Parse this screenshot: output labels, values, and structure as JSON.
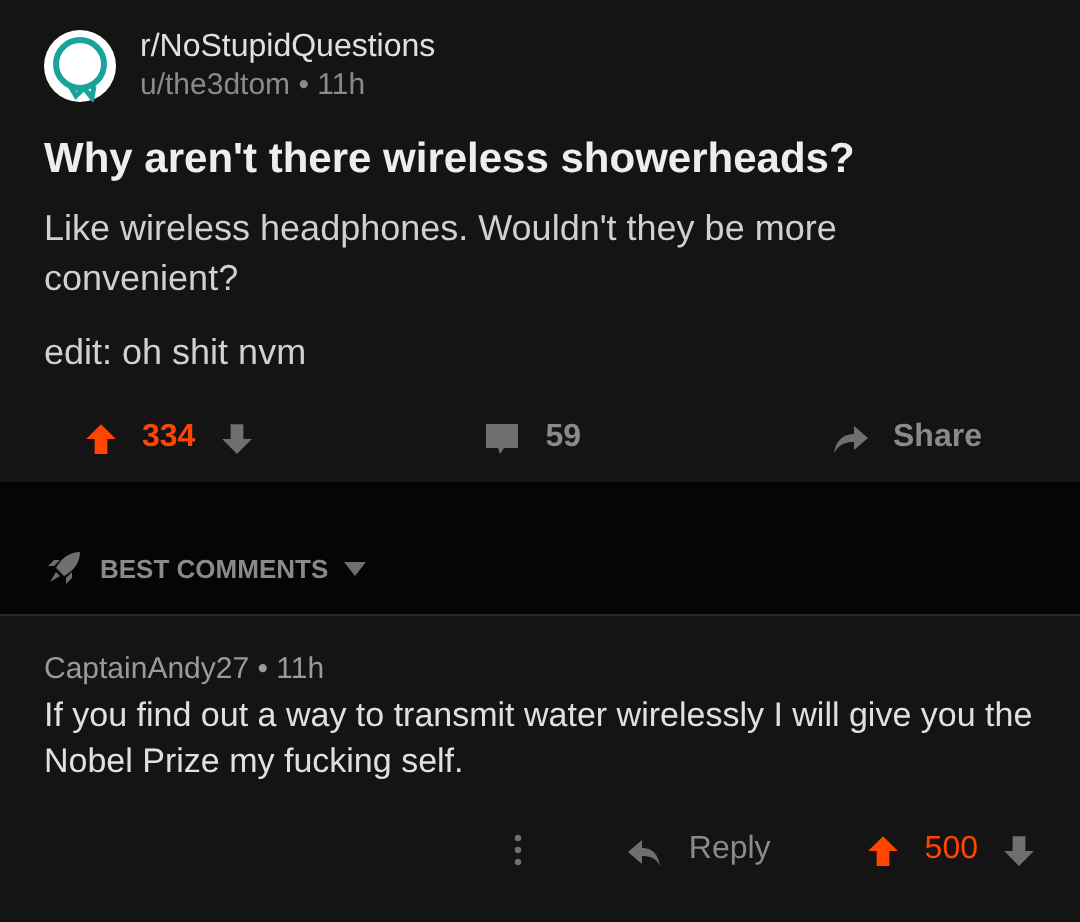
{
  "post": {
    "subreddit": "r/NoStupidQuestions",
    "author": "u/the3dtom",
    "age": "• 11h",
    "title": "Why aren't there wireless showerheads?",
    "body": [
      "Like wireless headphones. Wouldn't they be more convenient?",
      "edit: oh shit nvm"
    ],
    "score": "334",
    "upvoted": true,
    "comments": "59",
    "share": "Share"
  },
  "sort": {
    "label": "BEST COMMENTS"
  },
  "comments": [
    {
      "author": "CaptainAndy27",
      "age": "• 11h",
      "text": "If you find out a way to transmit water wirelessly I will give you the Nobel Prize my fucking self.",
      "reply": "Reply",
      "score": "500",
      "upvoted": true
    }
  ]
}
